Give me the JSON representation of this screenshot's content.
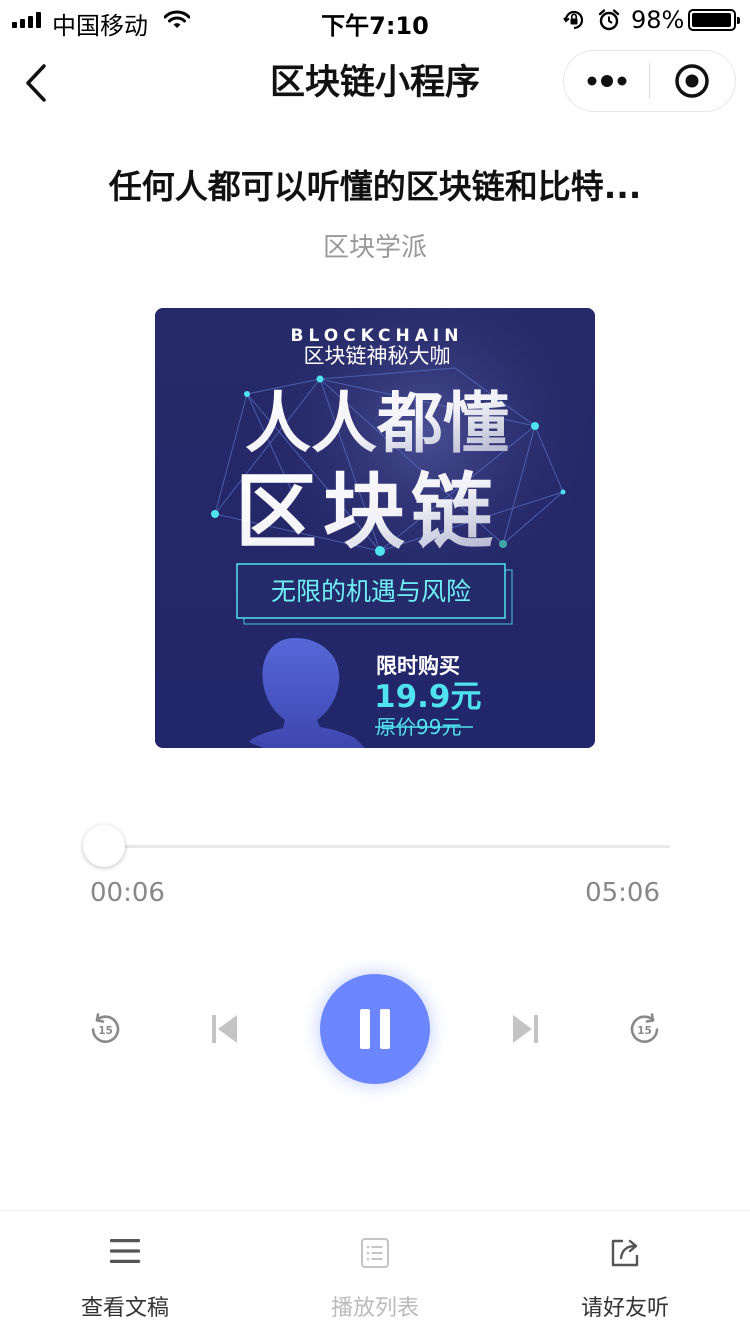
{
  "status_bar": {
    "carrier": "中国移动",
    "time": "下午7:10",
    "battery_percent": "98%",
    "battery_level": 0.98
  },
  "nav": {
    "title": "区块链小程序",
    "back_icon": "chevron-left-icon",
    "more_icon": "more-dots-icon",
    "close_icon": "target-circle-icon"
  },
  "track": {
    "title": "任何人都可以听懂的区块链和比特...",
    "author": "区块学派"
  },
  "cover": {
    "header_en": "BLOCKCHAIN",
    "header_cn": "区块链神秘大咖",
    "headline_line1": "人人都懂",
    "headline_line2": "区块链",
    "subtitle": "无限的机遇与风险",
    "promo_label": "限时购买",
    "price": "19.9元",
    "original_price": "原价99元",
    "colors": {
      "background": "#262a68",
      "accent": "#4fe3f0"
    }
  },
  "player": {
    "current_time": "00:06",
    "total_time": "05:06",
    "progress": 0.02,
    "state": "playing",
    "accent_color": "#6b86ff"
  },
  "tabs": [
    {
      "label": "查看文稿",
      "icon": "menu-lines-icon",
      "enabled": true
    },
    {
      "label": "播放列表",
      "icon": "playlist-icon",
      "enabled": false
    },
    {
      "label": "请好友听",
      "icon": "share-icon",
      "enabled": true
    }
  ]
}
